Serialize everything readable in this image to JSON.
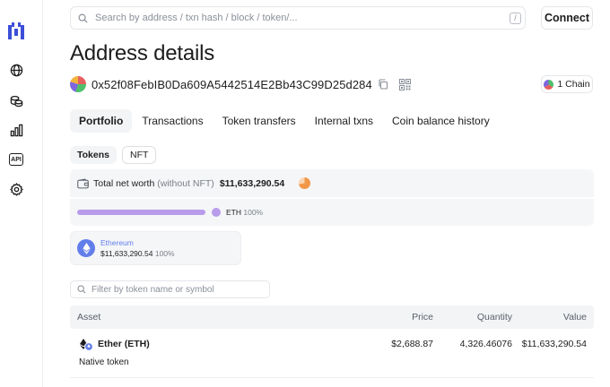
{
  "header": {
    "search_placeholder": "Search by address / txn hash / block / token/...",
    "search_shortcut": "/",
    "connect_label": "Connect"
  },
  "sidebar": {
    "items": [
      {
        "name": "globe-icon"
      },
      {
        "name": "tokens-icon"
      },
      {
        "name": "bar-chart-icon"
      },
      {
        "name": "api-icon",
        "label": "API"
      },
      {
        "name": "gear-icon"
      }
    ]
  },
  "page": {
    "title": "Address details",
    "address": "0x52f08FebIB0Da609A5442514E2Bb43C99D25d284",
    "chain_button": "1 Chain"
  },
  "tabs": [
    "Portfolio",
    "Transactions",
    "Token transfers",
    "Internal txns",
    "Coin balance history"
  ],
  "subtabs": [
    "Tokens",
    "NFT"
  ],
  "net_worth": {
    "label": "Total net worth",
    "qualifier": "(without NFT)",
    "value": "$11,633,290.54"
  },
  "distribution": {
    "symbol": "ETH",
    "percent_label": "100%",
    "fraction": 1.0,
    "color": "#b89ceb"
  },
  "chain_card": {
    "name": "Ethereum",
    "value": "$11,633,290.54",
    "percent": "100%"
  },
  "filter": {
    "placeholder": "Filter by token name or symbol"
  },
  "table": {
    "headers": [
      "Asset",
      "Price",
      "Quantity",
      "Value"
    ],
    "rows": [
      {
        "asset": "Ether (ETH)",
        "subtitle": "Native token",
        "price": "$2,688.87",
        "quantity": "4,326.46076",
        "value": "$11,633,290.54"
      }
    ]
  },
  "colors": {
    "accent_purple": "#b89ceb",
    "eth_blue": "#627eea",
    "logo_blue": "#3b4fd8"
  }
}
